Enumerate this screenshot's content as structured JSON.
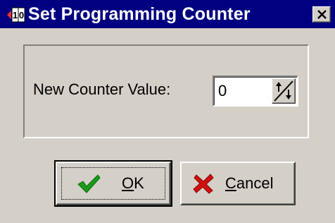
{
  "window": {
    "title": "Set Programming Counter",
    "title_icon": "counter-digits-icon",
    "close_icon": "close-icon"
  },
  "form": {
    "counter_label": "New Counter Value:",
    "counter_value": "0",
    "spin_icon": "spin-up-down-icon"
  },
  "buttons": {
    "ok": {
      "mnemonic": "O",
      "rest": "K",
      "icon": "checkmark-icon"
    },
    "cancel": {
      "mnemonic": "C",
      "rest": "ancel",
      "icon": "x-icon"
    }
  },
  "colors": {
    "titlebar": "#000080",
    "face": "#d4d0c8",
    "check_green": "#1a9a1a",
    "cancel_red": "#d01010"
  }
}
